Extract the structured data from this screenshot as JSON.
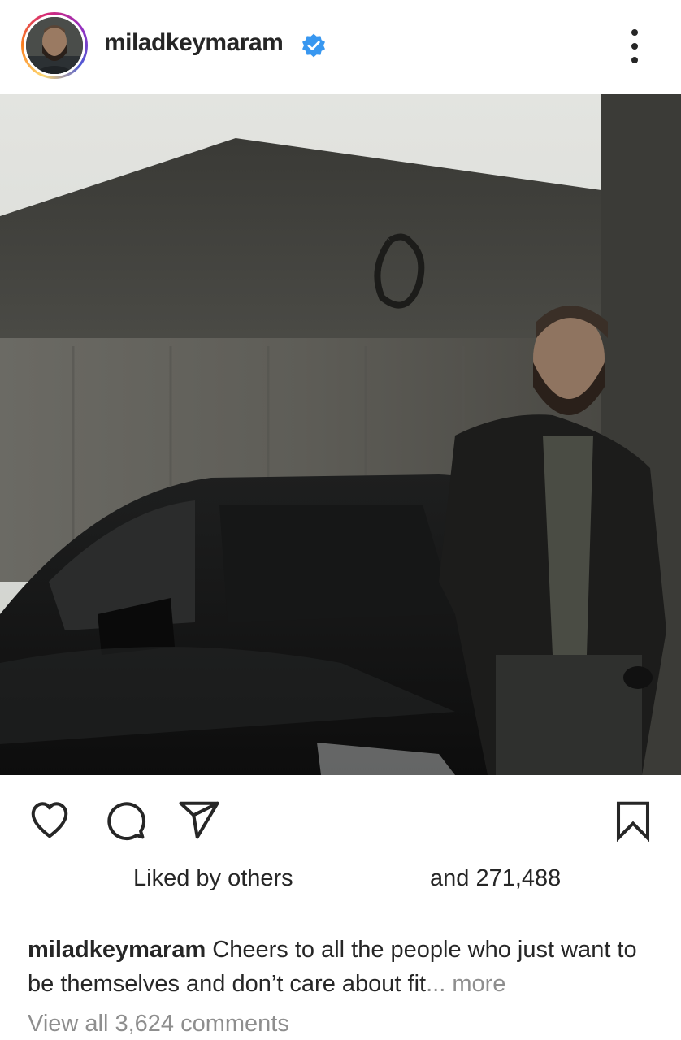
{
  "header": {
    "username": "miladkeymaram",
    "verified": true,
    "avatar_alt": "profile picture"
  },
  "photo": {
    "description_icon": "post-photo"
  },
  "actions": {
    "like_icon": "heart-icon",
    "comment_icon": "comment-icon",
    "share_icon": "send-icon",
    "save_icon": "bookmark-icon"
  },
  "likes": {
    "liked_by": "Liked by others",
    "and_count": "and 271,488"
  },
  "caption": {
    "user": "miladkeymaram",
    "text": " Cheers to all the people who just want to be themselves and don’t care about fit",
    "ellipsis": "...",
    "more": " more"
  },
  "comments": {
    "view_all": "View all 3,624 comments"
  },
  "colors": {
    "text": "#262626",
    "muted": "#8e8e8e",
    "verified_blue": "#3897f0"
  }
}
